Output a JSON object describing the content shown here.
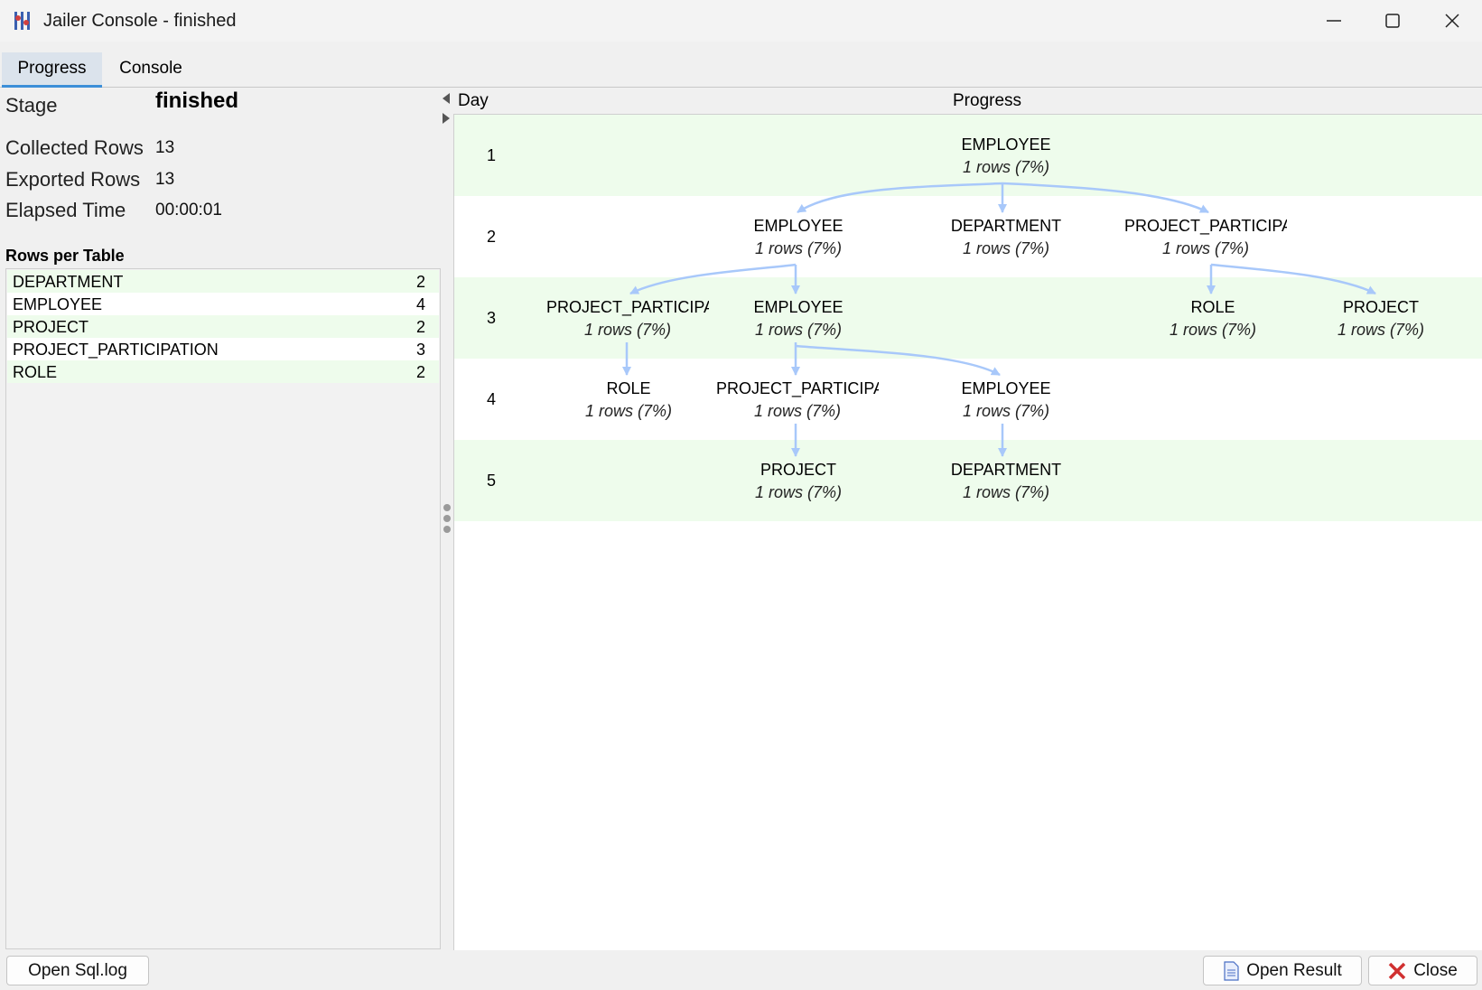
{
  "window": {
    "title": "Jailer Console - finished"
  },
  "tabs": [
    {
      "label": "Progress"
    },
    {
      "label": "Console"
    }
  ],
  "stats": {
    "stage_label": "Stage",
    "stage_value": "finished",
    "collected_label": "Collected Rows",
    "collected_value": "13",
    "exported_label": "Exported Rows",
    "exported_value": "13",
    "elapsed_label": "Elapsed Time",
    "elapsed_value": "00:00:01"
  },
  "rows_per_table": {
    "heading": "Rows per Table",
    "rows": [
      {
        "name": "DEPARTMENT",
        "count": "2"
      },
      {
        "name": "EMPLOYEE",
        "count": "4"
      },
      {
        "name": "PROJECT",
        "count": "2"
      },
      {
        "name": "PROJECT_PARTICIPATION",
        "count": "3"
      },
      {
        "name": "ROLE",
        "count": "2"
      }
    ]
  },
  "graph": {
    "col_day": "Day",
    "col_progress": "Progress",
    "days": [
      "1",
      "2",
      "3",
      "4",
      "5"
    ],
    "nodes": [
      {
        "title": "EMPLOYEE",
        "sub": "1 rows (7%)"
      },
      {
        "title": "EMPLOYEE",
        "sub": "1 rows (7%)"
      },
      {
        "title": "DEPARTMENT",
        "sub": "1 rows (7%)"
      },
      {
        "title": "PROJECT_PARTICIPA",
        "sub": "1 rows (7%)"
      },
      {
        "title": "PROJECT_PARTICIPA",
        "sub": "1 rows (7%)"
      },
      {
        "title": "EMPLOYEE",
        "sub": "1 rows (7%)"
      },
      {
        "title": "ROLE",
        "sub": "1 rows (7%)"
      },
      {
        "title": "PROJECT",
        "sub": "1 rows (7%)"
      },
      {
        "title": "ROLE",
        "sub": "1 rows (7%)"
      },
      {
        "title": "PROJECT_PARTICIPA",
        "sub": "1 rows (7%)"
      },
      {
        "title": "EMPLOYEE",
        "sub": "1 rows (7%)"
      },
      {
        "title": "PROJECT",
        "sub": "1 rows (7%)"
      },
      {
        "title": "DEPARTMENT",
        "sub": "1 rows (7%)"
      }
    ]
  },
  "buttons": {
    "open_sql_log": "Open Sql.log",
    "open_result": "Open Result",
    "close": "Close"
  },
  "colors": {
    "band_green": "#eefcec",
    "edge": "#a8c8fa",
    "tab_accent": "#3c8fd8",
    "close_x": "#d03030"
  },
  "icons": [
    "app-icon",
    "minimize-icon",
    "maximize-icon",
    "close-icon",
    "collapse-left-icon",
    "expand-right-icon",
    "document-icon",
    "red-x-icon"
  ]
}
